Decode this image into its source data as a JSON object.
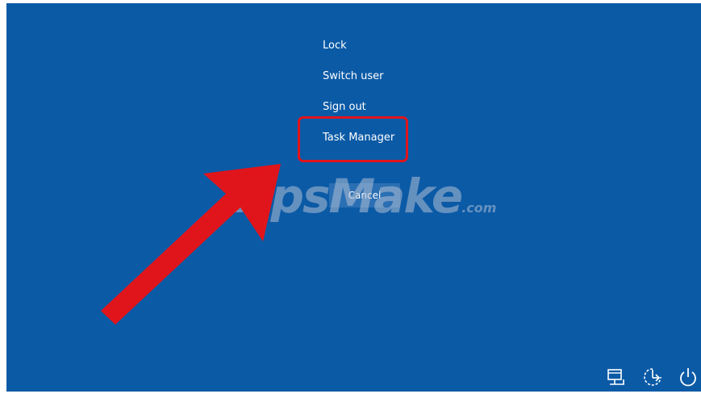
{
  "menu": {
    "items": [
      {
        "label": "Lock"
      },
      {
        "label": "Switch user"
      },
      {
        "label": "Sign out"
      },
      {
        "label": "Task Manager"
      }
    ],
    "highlighted_item": "Task Manager"
  },
  "cancel": {
    "label": "Cancel"
  },
  "watermark": {
    "main": "TipsMake",
    "suffix": ".com"
  },
  "system_tray": {
    "icons": [
      "network-icon",
      "ease-of-access-icon",
      "power-icon"
    ]
  },
  "colors": {
    "background": "#0b5aa6",
    "menu_text": "#ffffff",
    "annotation_red": "#e0151b",
    "cancel_button": "#2a6fb3"
  }
}
